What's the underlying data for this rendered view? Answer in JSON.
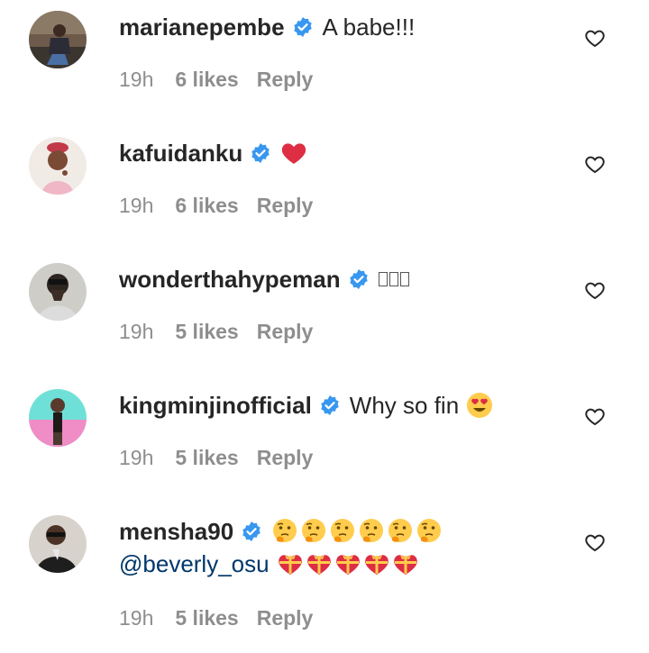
{
  "comments": [
    {
      "username": "marianepembe",
      "verified": true,
      "text": "A babe!!!",
      "time": "19h",
      "likes": "6 likes",
      "reply_label": "Reply",
      "avatar_icon": "avatar-photo"
    },
    {
      "username": "kafuidanku",
      "verified": true,
      "text": "",
      "emoji": [
        "red-heart"
      ],
      "time": "19h",
      "likes": "6 likes",
      "reply_label": "Reply",
      "avatar_icon": "avatar-photo"
    },
    {
      "username": "wonderthahypeman",
      "verified": true,
      "text": "",
      "emoji": [
        "missing-glyph",
        "missing-glyph",
        "missing-glyph"
      ],
      "time": "19h",
      "likes": "5 likes",
      "reply_label": "Reply",
      "avatar_icon": "avatar-photo"
    },
    {
      "username": "kingminjinofficial",
      "verified": true,
      "text": "Why so fin",
      "emoji": [
        "heart-eyes-face"
      ],
      "time": "19h",
      "likes": "5 likes",
      "reply_label": "Reply",
      "avatar_icon": "avatar-photo"
    },
    {
      "username": "mensha90",
      "verified": true,
      "text": "",
      "emoji": [
        "thinking-face",
        "thinking-face",
        "thinking-face",
        "thinking-face",
        "thinking-face",
        "thinking-face"
      ],
      "mention": "@beverly_osu",
      "emoji_line2": [
        "gift-heart",
        "gift-heart",
        "gift-heart",
        "gift-heart",
        "gift-heart"
      ],
      "time": "19h",
      "likes": "5 likes",
      "reply_label": "Reply",
      "avatar_icon": "avatar-photo"
    }
  ],
  "colors": {
    "verified_badge": "#3897f0",
    "muted_text": "#8e8e8e",
    "mention": "#00376b",
    "heart_red": "#dd2e44"
  }
}
